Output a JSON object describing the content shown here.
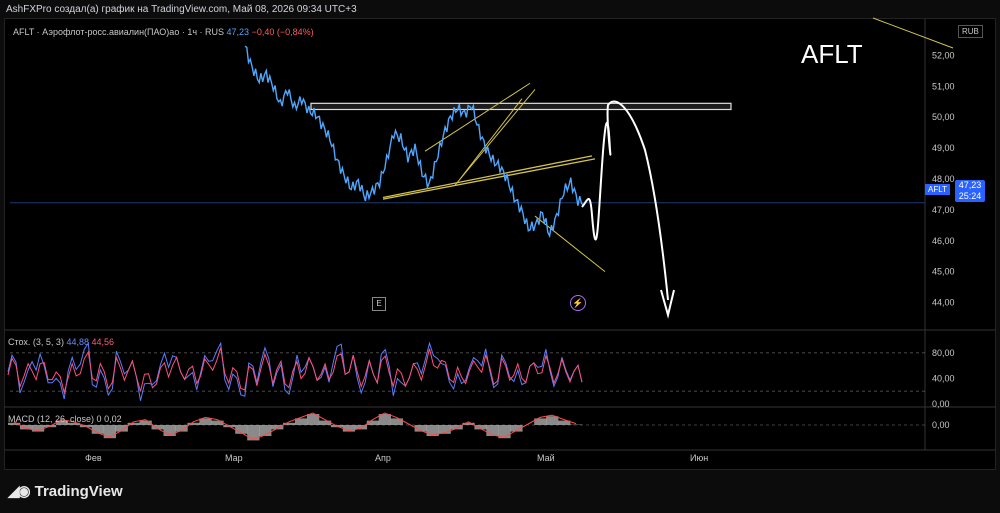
{
  "header": {
    "attribution": "AshFXPro создал(а) график на TradingView.com, Май 08, 2026 09:34 UTC+3"
  },
  "symbol_line": {
    "text": "AFLT · Аэрофлот-росс.авиалин(ПАО)ао · 1ч · RUS",
    "value": "47,23",
    "change": "−0,40 (−0,84%)"
  },
  "big_symbol": "AFLT",
  "currency": "RUB",
  "price_tag": {
    "symbol": "AFLT",
    "price": "47,23",
    "countdown": "25:24"
  },
  "badges": {
    "earnings": "E"
  },
  "stochastic": {
    "label": "Стох. (3, 5, 3)",
    "k": "44,88",
    "d": "44,56"
  },
  "macd": {
    "label": "MACD (12, 26, close)",
    "v1": "0",
    "v2": "0,02"
  },
  "footer": {
    "brand": "TradingView"
  },
  "colors": {
    "price_line": "#4ea7ff",
    "trend": "#d4c24a",
    "stoch_k": "#5a7dff",
    "stoch_d": "#ff4f7b",
    "macd_hist": "#b8b8b8",
    "macd_signal": "#ff4a4a"
  },
  "chart_data": [
    {
      "type": "line",
      "title": "AFLT · Аэрофлот-росс.авиалин(ПАО)ао · 1ч · RUS",
      "ylabel": "RUB",
      "ylim": [
        43.5,
        52.5
      ],
      "yticks": [
        "52,00",
        "51,00",
        "50,00",
        "49,00",
        "48,00",
        "47,00",
        "46,00",
        "45,00",
        "44,00"
      ],
      "xticks": [
        "Фев",
        "Мар",
        "Апр",
        "Май",
        "Июн"
      ],
      "series": [
        {
          "values": [
            52.3,
            51.6,
            51.2,
            51.4,
            51.0,
            50.4,
            50.9,
            50.3,
            50.6,
            50.2,
            50.1,
            49.7,
            49.3,
            48.6,
            48.1,
            47.7,
            47.9,
            47.4,
            47.6,
            47.9,
            48.6,
            49.5,
            49.3,
            48.7,
            49.0,
            48.2,
            47.8,
            48.6,
            49.4,
            50.0,
            50.3,
            50.1,
            50.4,
            49.6,
            49.0,
            48.6,
            48.4,
            48.0,
            47.4,
            47.0,
            46.4,
            46.5,
            46.9,
            46.2,
            46.8,
            47.6,
            47.9,
            47.3,
            47.23
          ]
        }
      ],
      "annotations": [
        "resistance zone ~50,3",
        "rising wedge",
        "projected path: rise to ~50,3 then fall toward ~44,0"
      ]
    },
    {
      "type": "line",
      "title": "Стох. (3, 5, 3)",
      "ylim": [
        0,
        100
      ],
      "yticks": [
        "80,00",
        "40,00",
        "0,00"
      ],
      "series": [
        {
          "name": "K",
          "values": [
            60,
            35,
            70,
            45,
            25,
            55,
            80,
            40,
            30,
            65,
            50,
            20,
            45,
            75,
            55,
            35,
            60,
            85,
            40,
            25,
            50,
            70,
            45,
            30,
            65,
            55,
            40,
            80,
            60,
            35,
            50,
            70,
            25,
            45,
            65,
            85,
            50,
            30,
            55,
            75,
            40,
            60,
            35,
            50,
            70,
            45,
            55,
            44.88
          ]
        },
        {
          "name": "D",
          "values": [
            55,
            45,
            55,
            50,
            35,
            45,
            65,
            50,
            40,
            55,
            50,
            35,
            40,
            60,
            55,
            45,
            55,
            70,
            50,
            35,
            45,
            60,
            50,
            40,
            55,
            55,
            45,
            65,
            60,
            45,
            50,
            60,
            40,
            45,
            55,
            70,
            55,
            40,
            50,
            65,
            45,
            55,
            45,
            50,
            60,
            50,
            52,
            44.56
          ]
        }
      ]
    },
    {
      "type": "area",
      "title": "MACD (12, 26, close)",
      "yticks": [
        "0,00"
      ],
      "series": [
        {
          "name": "histogram",
          "values": [
            0.1,
            -0.2,
            -0.3,
            -0.1,
            0.2,
            0.1,
            -0.1,
            -0.4,
            -0.6,
            -0.3,
            0.1,
            0.2,
            -0.2,
            -0.5,
            -0.3,
            0.1,
            0.3,
            0.2,
            -0.1,
            -0.4,
            -0.7,
            -0.5,
            -0.2,
            0.1,
            0.3,
            0.5,
            0.2,
            -0.1,
            -0.3,
            -0.2,
            0.2,
            0.5,
            0.3,
            0.0,
            -0.3,
            -0.5,
            -0.4,
            -0.2,
            0.1,
            -0.2,
            -0.5,
            -0.6,
            -0.3,
            0.0,
            0.3,
            0.4,
            0.2,
            0.02
          ]
        }
      ]
    }
  ]
}
